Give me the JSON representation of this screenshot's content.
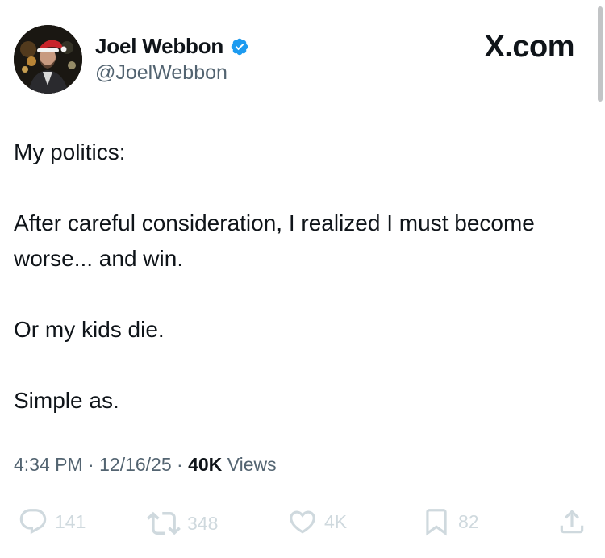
{
  "author": {
    "display_name": "Joel Webbon",
    "handle": "@JoelWebbon",
    "verified_badge_icon": "verified-badge-icon",
    "badge_color": "#1d9bf0"
  },
  "brand": {
    "label": "X.com"
  },
  "tweet": {
    "paragraphs": [
      "My politics:",
      "After careful consideration, I realized I must become worse... and win.",
      "Or my kids die.",
      "Simple as."
    ]
  },
  "meta": {
    "time": "4:34 PM",
    "separator": "·",
    "date": "12/16/25",
    "views_count": "40K",
    "views_label": "Views"
  },
  "actions": {
    "replies": {
      "icon": "reply-icon",
      "count": "141"
    },
    "reposts": {
      "icon": "repost-icon",
      "count": "348"
    },
    "likes": {
      "icon": "heart-icon",
      "count": "4K"
    },
    "bookmarks": {
      "icon": "bookmark-icon",
      "count": "82"
    },
    "share": {
      "icon": "share-icon"
    }
  },
  "colors": {
    "text": "#0f1419",
    "secondary": "#536471",
    "faded_action": "#cfd9de"
  }
}
